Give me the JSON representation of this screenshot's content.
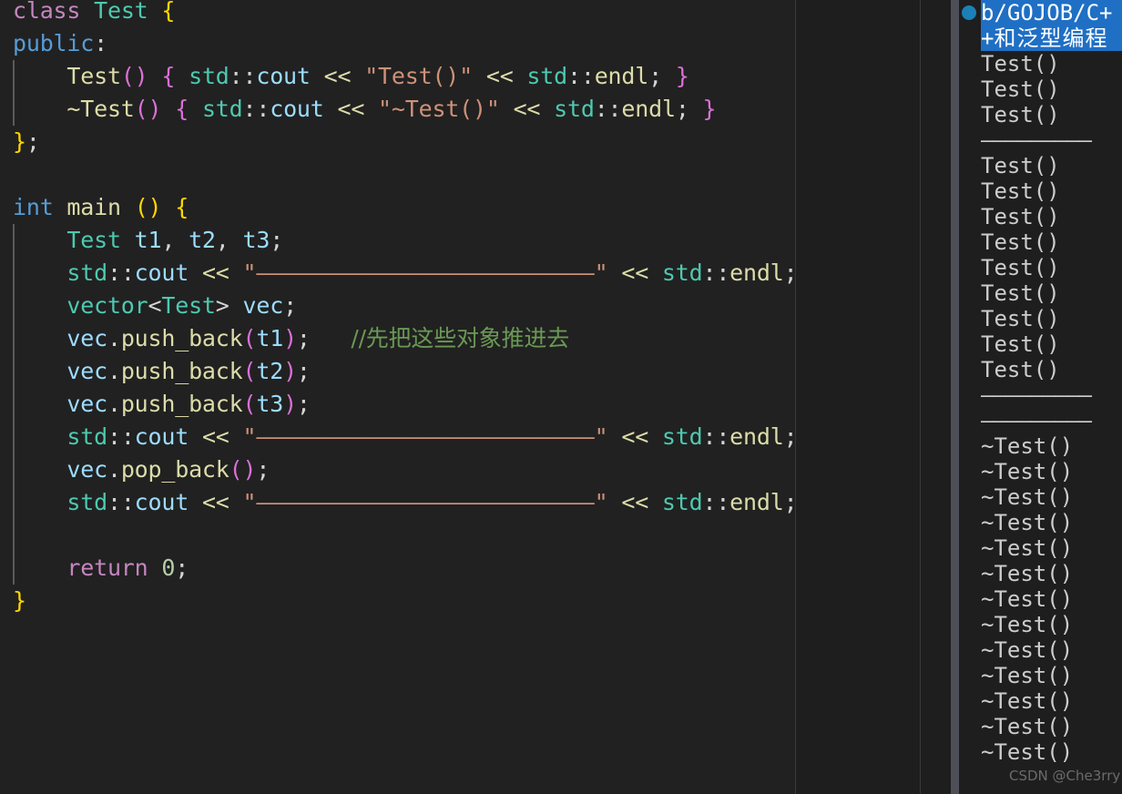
{
  "theme": {
    "editor_background": "#212121",
    "terminal_background": "#1e1e1e",
    "terminal_title_background": "#1f6fc4",
    "terminal_text": "#cccccc",
    "accent_dot": "#1b80b8",
    "scrollbar_thumb": "#4e4e58",
    "indent_guide": "#5a5a5a"
  },
  "editor": {
    "language": "cpp",
    "lines": [
      {
        "n": 1,
        "guide": false,
        "tokens": [
          {
            "t": "class",
            "c": "t-kw2"
          },
          {
            "t": " ",
            "c": "t-plain"
          },
          {
            "t": "Test",
            "c": "t-type"
          },
          {
            "t": " ",
            "c": "t-plain"
          },
          {
            "t": "{",
            "c": "t-br-y"
          }
        ]
      },
      {
        "n": 2,
        "guide": false,
        "tokens": [
          {
            "t": "public",
            "c": "t-key"
          },
          {
            "t": ":",
            "c": "t-plain"
          }
        ]
      },
      {
        "n": 3,
        "guide": true,
        "tokens": [
          {
            "t": "    ",
            "c": "t-plain"
          },
          {
            "t": "Test",
            "c": "t-fn"
          },
          {
            "t": "()",
            "c": "t-br-m"
          },
          {
            "t": " ",
            "c": "t-plain"
          },
          {
            "t": "{",
            "c": "t-br-m"
          },
          {
            "t": " ",
            "c": "t-plain"
          },
          {
            "t": "std",
            "c": "t-type"
          },
          {
            "t": "::",
            "c": "t-op"
          },
          {
            "t": "cout",
            "c": "t-var"
          },
          {
            "t": " ",
            "c": "t-plain"
          },
          {
            "t": "<<",
            "c": "t-shift"
          },
          {
            "t": " ",
            "c": "t-plain"
          },
          {
            "t": "\"Test()\"",
            "c": "t-str"
          },
          {
            "t": " ",
            "c": "t-plain"
          },
          {
            "t": "<<",
            "c": "t-shift"
          },
          {
            "t": " ",
            "c": "t-plain"
          },
          {
            "t": "std",
            "c": "t-type"
          },
          {
            "t": "::",
            "c": "t-op"
          },
          {
            "t": "endl",
            "c": "t-fn"
          },
          {
            "t": ";",
            "c": "t-plain"
          },
          {
            "t": " ",
            "c": "t-plain"
          },
          {
            "t": "}",
            "c": "t-br-m"
          }
        ]
      },
      {
        "n": 4,
        "guide": true,
        "tokens": [
          {
            "t": "    ",
            "c": "t-plain"
          },
          {
            "t": "~Test",
            "c": "t-fn"
          },
          {
            "t": "()",
            "c": "t-br-m"
          },
          {
            "t": " ",
            "c": "t-plain"
          },
          {
            "t": "{",
            "c": "t-br-m"
          },
          {
            "t": " ",
            "c": "t-plain"
          },
          {
            "t": "std",
            "c": "t-type"
          },
          {
            "t": "::",
            "c": "t-op"
          },
          {
            "t": "cout",
            "c": "t-var"
          },
          {
            "t": " ",
            "c": "t-plain"
          },
          {
            "t": "<<",
            "c": "t-shift"
          },
          {
            "t": " ",
            "c": "t-plain"
          },
          {
            "t": "\"~Test()\"",
            "c": "t-str"
          },
          {
            "t": " ",
            "c": "t-plain"
          },
          {
            "t": "<<",
            "c": "t-shift"
          },
          {
            "t": " ",
            "c": "t-plain"
          },
          {
            "t": "std",
            "c": "t-type"
          },
          {
            "t": "::",
            "c": "t-op"
          },
          {
            "t": "endl",
            "c": "t-fn"
          },
          {
            "t": ";",
            "c": "t-plain"
          },
          {
            "t": " ",
            "c": "t-plain"
          },
          {
            "t": "}",
            "c": "t-br-m"
          }
        ]
      },
      {
        "n": 5,
        "guide": false,
        "tokens": [
          {
            "t": "}",
            "c": "t-br-y"
          },
          {
            "t": ";",
            "c": "t-plain"
          }
        ]
      },
      {
        "n": 6,
        "guide": false,
        "tokens": []
      },
      {
        "n": 7,
        "guide": false,
        "tokens": [
          {
            "t": "int",
            "c": "t-key"
          },
          {
            "t": " ",
            "c": "t-plain"
          },
          {
            "t": "main",
            "c": "t-fn"
          },
          {
            "t": " ",
            "c": "t-plain"
          },
          {
            "t": "()",
            "c": "t-br-y"
          },
          {
            "t": " ",
            "c": "t-plain"
          },
          {
            "t": "{",
            "c": "t-br-y"
          }
        ]
      },
      {
        "n": 8,
        "guide": true,
        "tokens": [
          {
            "t": "    ",
            "c": "t-plain"
          },
          {
            "t": "Test",
            "c": "t-type"
          },
          {
            "t": " ",
            "c": "t-plain"
          },
          {
            "t": "t1",
            "c": "t-var"
          },
          {
            "t": ", ",
            "c": "t-plain"
          },
          {
            "t": "t2",
            "c": "t-var"
          },
          {
            "t": ", ",
            "c": "t-plain"
          },
          {
            "t": "t3",
            "c": "t-var"
          },
          {
            "t": ";",
            "c": "t-plain"
          }
        ]
      },
      {
        "n": 9,
        "guide": true,
        "tokens": [
          {
            "t": "    ",
            "c": "t-plain"
          },
          {
            "t": "std",
            "c": "t-type"
          },
          {
            "t": "::",
            "c": "t-op"
          },
          {
            "t": "cout",
            "c": "t-var"
          },
          {
            "t": " ",
            "c": "t-plain"
          },
          {
            "t": "<<",
            "c": "t-shift"
          },
          {
            "t": " ",
            "c": "t-plain"
          },
          {
            "t": "\"—————————————————————————\"",
            "c": "t-str"
          },
          {
            "t": " ",
            "c": "t-plain"
          },
          {
            "t": "<<",
            "c": "t-shift"
          },
          {
            "t": " ",
            "c": "t-plain"
          },
          {
            "t": "std",
            "c": "t-type"
          },
          {
            "t": "::",
            "c": "t-op"
          },
          {
            "t": "endl",
            "c": "t-fn"
          },
          {
            "t": ";",
            "c": "t-plain"
          }
        ]
      },
      {
        "n": 10,
        "guide": true,
        "tokens": [
          {
            "t": "    ",
            "c": "t-plain"
          },
          {
            "t": "vector",
            "c": "t-type"
          },
          {
            "t": "<",
            "c": "t-plain"
          },
          {
            "t": "Test",
            "c": "t-type"
          },
          {
            "t": ">",
            "c": "t-plain"
          },
          {
            "t": " ",
            "c": "t-plain"
          },
          {
            "t": "vec",
            "c": "t-var"
          },
          {
            "t": ";",
            "c": "t-plain"
          }
        ]
      },
      {
        "n": 11,
        "guide": true,
        "tokens": [
          {
            "t": "    ",
            "c": "t-plain"
          },
          {
            "t": "vec",
            "c": "t-var"
          },
          {
            "t": ".",
            "c": "t-plain"
          },
          {
            "t": "push_back",
            "c": "t-fn"
          },
          {
            "t": "(",
            "c": "t-br-m"
          },
          {
            "t": "t1",
            "c": "t-var"
          },
          {
            "t": ")",
            "c": "t-br-m"
          },
          {
            "t": ";",
            "c": "t-plain"
          },
          {
            "t": "   ",
            "c": "t-plain"
          },
          {
            "t": "//先把这些对象推进去",
            "c": "t-cmt t-cmt-cjk"
          }
        ]
      },
      {
        "n": 12,
        "guide": true,
        "tokens": [
          {
            "t": "    ",
            "c": "t-plain"
          },
          {
            "t": "vec",
            "c": "t-var"
          },
          {
            "t": ".",
            "c": "t-plain"
          },
          {
            "t": "push_back",
            "c": "t-fn"
          },
          {
            "t": "(",
            "c": "t-br-m"
          },
          {
            "t": "t2",
            "c": "t-var"
          },
          {
            "t": ")",
            "c": "t-br-m"
          },
          {
            "t": ";",
            "c": "t-plain"
          }
        ]
      },
      {
        "n": 13,
        "guide": true,
        "tokens": [
          {
            "t": "    ",
            "c": "t-plain"
          },
          {
            "t": "vec",
            "c": "t-var"
          },
          {
            "t": ".",
            "c": "t-plain"
          },
          {
            "t": "push_back",
            "c": "t-fn"
          },
          {
            "t": "(",
            "c": "t-br-m"
          },
          {
            "t": "t3",
            "c": "t-var"
          },
          {
            "t": ")",
            "c": "t-br-m"
          },
          {
            "t": ";",
            "c": "t-plain"
          }
        ]
      },
      {
        "n": 14,
        "guide": true,
        "tokens": [
          {
            "t": "    ",
            "c": "t-plain"
          },
          {
            "t": "std",
            "c": "t-type"
          },
          {
            "t": "::",
            "c": "t-op"
          },
          {
            "t": "cout",
            "c": "t-var"
          },
          {
            "t": " ",
            "c": "t-plain"
          },
          {
            "t": "<<",
            "c": "t-shift"
          },
          {
            "t": " ",
            "c": "t-plain"
          },
          {
            "t": "\"—————————————————————————\"",
            "c": "t-str"
          },
          {
            "t": " ",
            "c": "t-plain"
          },
          {
            "t": "<<",
            "c": "t-shift"
          },
          {
            "t": " ",
            "c": "t-plain"
          },
          {
            "t": "std",
            "c": "t-type"
          },
          {
            "t": "::",
            "c": "t-op"
          },
          {
            "t": "endl",
            "c": "t-fn"
          },
          {
            "t": ";",
            "c": "t-plain"
          }
        ]
      },
      {
        "n": 15,
        "guide": true,
        "tokens": [
          {
            "t": "    ",
            "c": "t-plain"
          },
          {
            "t": "vec",
            "c": "t-var"
          },
          {
            "t": ".",
            "c": "t-plain"
          },
          {
            "t": "pop_back",
            "c": "t-fn"
          },
          {
            "t": "()",
            "c": "t-br-m"
          },
          {
            "t": ";",
            "c": "t-plain"
          }
        ]
      },
      {
        "n": 16,
        "guide": true,
        "tokens": [
          {
            "t": "    ",
            "c": "t-plain"
          },
          {
            "t": "std",
            "c": "t-type"
          },
          {
            "t": "::",
            "c": "t-op"
          },
          {
            "t": "cout",
            "c": "t-var"
          },
          {
            "t": " ",
            "c": "t-plain"
          },
          {
            "t": "<<",
            "c": "t-shift"
          },
          {
            "t": " ",
            "c": "t-plain"
          },
          {
            "t": "\"—————————————————————————\"",
            "c": "t-str"
          },
          {
            "t": " ",
            "c": "t-plain"
          },
          {
            "t": "<<",
            "c": "t-shift"
          },
          {
            "t": " ",
            "c": "t-plain"
          },
          {
            "t": "std",
            "c": "t-type"
          },
          {
            "t": "::",
            "c": "t-op"
          },
          {
            "t": "endl",
            "c": "t-fn"
          },
          {
            "t": ";",
            "c": "t-plain"
          }
        ]
      },
      {
        "n": 17,
        "guide": true,
        "tokens": []
      },
      {
        "n": 18,
        "guide": true,
        "tokens": [
          {
            "t": "    ",
            "c": "t-plain"
          },
          {
            "t": "return",
            "c": "t-kw2"
          },
          {
            "t": " ",
            "c": "t-plain"
          },
          {
            "t": "0",
            "c": "t-num"
          },
          {
            "t": ";",
            "c": "t-plain"
          }
        ]
      },
      {
        "n": 19,
        "guide": false,
        "tokens": [
          {
            "t": "}",
            "c": "t-br-y"
          }
        ]
      }
    ]
  },
  "terminal": {
    "status_dot": "active",
    "title": "b/GOJOB/C++和泛型编程",
    "title_ascii": "b/GOJOB/C++",
    "title_cjk": "和泛型编程",
    "separator": "—————————",
    "lines": [
      {
        "text": "Test()",
        "kind": "out"
      },
      {
        "text": "Test()",
        "kind": "out"
      },
      {
        "text": "Test()",
        "kind": "out"
      },
      {
        "text": "—————————",
        "kind": "sep"
      },
      {
        "text": "Test()",
        "kind": "out"
      },
      {
        "text": "Test()",
        "kind": "out"
      },
      {
        "text": "Test()",
        "kind": "out"
      },
      {
        "text": "Test()",
        "kind": "out"
      },
      {
        "text": "Test()",
        "kind": "out"
      },
      {
        "text": "Test()",
        "kind": "out"
      },
      {
        "text": "Test()",
        "kind": "out"
      },
      {
        "text": "Test()",
        "kind": "out"
      },
      {
        "text": "Test()",
        "kind": "out"
      },
      {
        "text": "—————————",
        "kind": "sep"
      },
      {
        "text": "—————————",
        "kind": "sep"
      },
      {
        "text": "~Test()",
        "kind": "out"
      },
      {
        "text": "~Test()",
        "kind": "out"
      },
      {
        "text": "~Test()",
        "kind": "out"
      },
      {
        "text": "~Test()",
        "kind": "out"
      },
      {
        "text": "~Test()",
        "kind": "out"
      },
      {
        "text": "~Test()",
        "kind": "out"
      },
      {
        "text": "~Test()",
        "kind": "out"
      },
      {
        "text": "~Test()",
        "kind": "out"
      },
      {
        "text": "~Test()",
        "kind": "out"
      },
      {
        "text": "~Test()",
        "kind": "out"
      },
      {
        "text": "~Test()",
        "kind": "out"
      },
      {
        "text": "~Test()",
        "kind": "out"
      },
      {
        "text": "~Test()",
        "kind": "out"
      }
    ]
  },
  "watermark": {
    "text": "CSDN @Che3rry"
  }
}
